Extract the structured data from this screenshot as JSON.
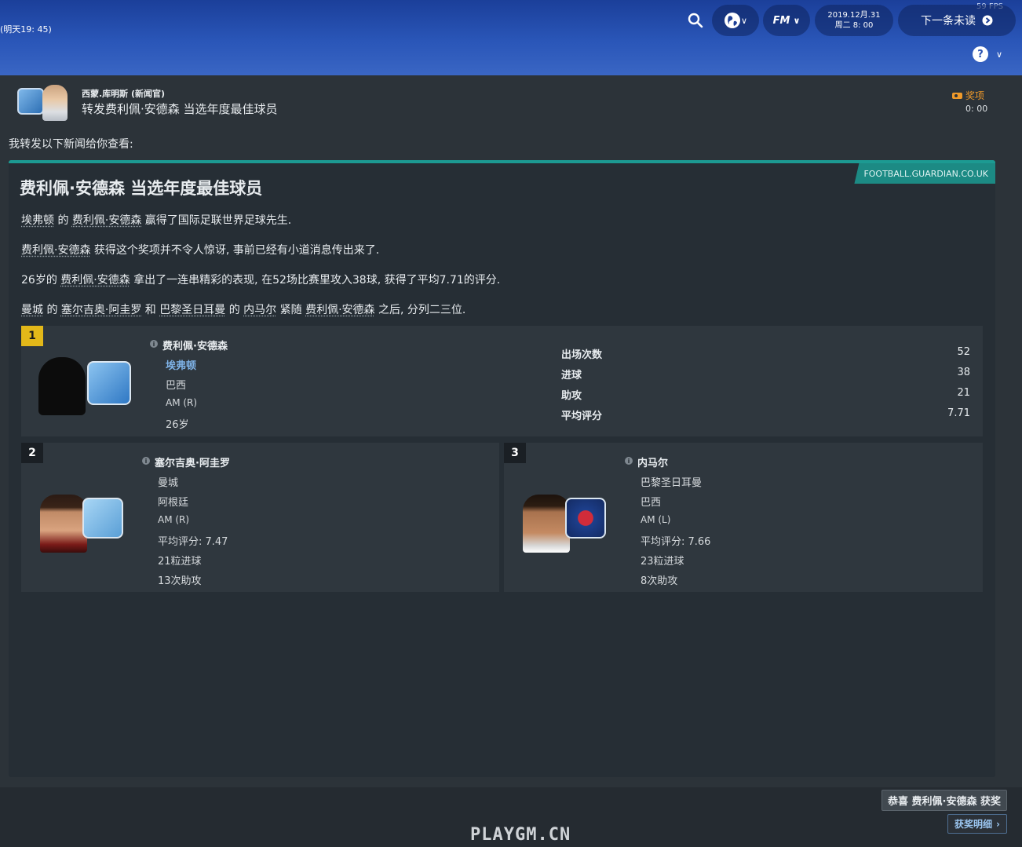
{
  "topbar": {
    "status": "(明天19: 45)",
    "fps": "59 FPS",
    "fm_label": "FM",
    "date_line1": "2019.12月.31",
    "date_line2": "周二 8: 00",
    "next_label": "下一条未读",
    "help_label": "?"
  },
  "message": {
    "sender": "西蒙.库明斯 (新闻官)",
    "subject": "转发费利佩·安德森 当选年度最佳球员",
    "tag": "奖项",
    "time": "0: 00",
    "intro": "我转发以下新闻给你查看:"
  },
  "article": {
    "source": "FOOTBALL.GUARDIAN.CO.UK",
    "headline": "费利佩·安德森 当选年度最佳球员",
    "p1": {
      "a": "埃弗顿",
      "b": " 的 ",
      "c": "费利佩·安德森",
      "d": " 赢得了国际足联世界足球先生."
    },
    "p2": {
      "a": "费利佩·安德森",
      "b": " 获得这个奖项并不令人惊讶, 事前已经有小道消息传出来了."
    },
    "p3": {
      "a": "26岁的 ",
      "b": "费利佩·安德森",
      "c": " 拿出了一连串精彩的表现, 在52场比赛里攻入38球, 获得了平均7.71的评分."
    },
    "p4": {
      "a": "曼城",
      "b": " 的 ",
      "c": "塞尔吉奥·阿圭罗",
      "d": " 和 ",
      "e": "巴黎圣日耳曼",
      "f": " 的 ",
      "g": "内马尔",
      "h": " 紧随 ",
      "i": "费利佩·安德森",
      "j": " 之后, 分列二三位."
    }
  },
  "first": {
    "rank": "1",
    "name": "费利佩·安德森",
    "club": "埃弗顿",
    "nation": "巴西",
    "position": "AM (R)",
    "age": "26岁",
    "stats": [
      {
        "label": "出场次数",
        "value": "52"
      },
      {
        "label": "进球",
        "value": "38"
      },
      {
        "label": "助攻",
        "value": "21"
      },
      {
        "label": "平均评分",
        "value": "7.71"
      }
    ]
  },
  "second": {
    "rank": "2",
    "name": "塞尔吉奥·阿圭罗",
    "club": "曼城",
    "nation": "阿根廷",
    "position": "AM (R)",
    "rating": "平均评分: 7.47",
    "goals": "21粒进球",
    "assists": "13次助攻"
  },
  "third": {
    "rank": "3",
    "name": "内马尔",
    "club": "巴黎圣日耳曼",
    "nation": "巴西",
    "position": "AM (L)",
    "rating": "平均评分: 7.66",
    "goals": "23粒进球",
    "assists": "8次助攻"
  },
  "bottom": {
    "congrats_label": "恭喜 费利佩·安德森 获奖",
    "details_label": "获奖明细",
    "watermark": "PLAYGM.CN"
  },
  "colors": {
    "accent_teal": "#1c9a92",
    "rank_gold": "#e3b819",
    "award_orange": "#f09a2a",
    "link_blue": "#7fb3e8"
  },
  "icons": [
    "search-icon",
    "globe-icon",
    "chevron-down-icon",
    "arrow-right-circle-icon",
    "help-icon",
    "tag-icon",
    "info-icon",
    "chevron-right-icon"
  ]
}
